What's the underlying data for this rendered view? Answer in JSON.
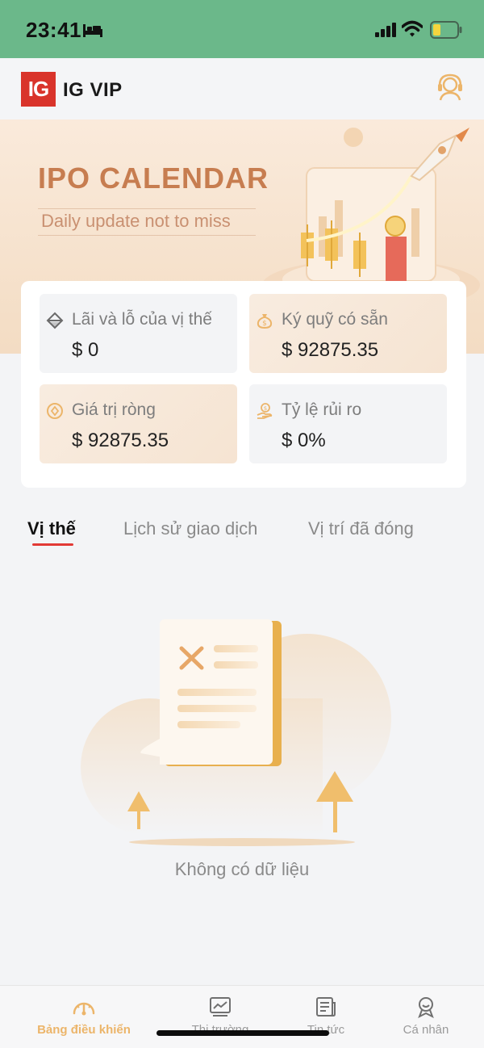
{
  "status_bar": {
    "time": "23:41"
  },
  "header": {
    "logo_text": "IG",
    "title": "IG VIP"
  },
  "banner": {
    "title": "IPO CALENDAR",
    "subtitle": "Daily update not to miss"
  },
  "stats": [
    {
      "label": "Lãi và lỗ của vị thế",
      "value": "$ 0",
      "icon": "diamond-icon"
    },
    {
      "label": "Ký quỹ có sẵn",
      "value": "$ 92875.35",
      "icon": "money-bag-icon"
    },
    {
      "label": "Giá trị ròng",
      "value": "$ 92875.35",
      "icon": "coin-icon"
    },
    {
      "label": "Tỷ lệ rủi ro",
      "value": "$ 0%",
      "icon": "hand-coin-icon"
    }
  ],
  "tabs": [
    {
      "label": "Vị thế",
      "active": true
    },
    {
      "label": "Lịch sử giao dịch",
      "active": false
    },
    {
      "label": "Vị trí đã đóng",
      "active": false
    }
  ],
  "empty_state": {
    "text": "Không có dữ liệu"
  },
  "bottom_nav": [
    {
      "label": "Bảng điều khiển",
      "icon": "dashboard-gauge-icon",
      "active": true
    },
    {
      "label": "Thị trường",
      "icon": "market-chart-icon",
      "active": false
    },
    {
      "label": "Tin tức",
      "icon": "news-icon",
      "active": false
    },
    {
      "label": "Cá nhân",
      "icon": "profile-icon",
      "active": false
    }
  ],
  "colors": {
    "status_bar": "#6bb88a",
    "brand_red": "#d9342b",
    "accent_gold": "#ecb56a",
    "tab_underline": "#e23a35"
  }
}
